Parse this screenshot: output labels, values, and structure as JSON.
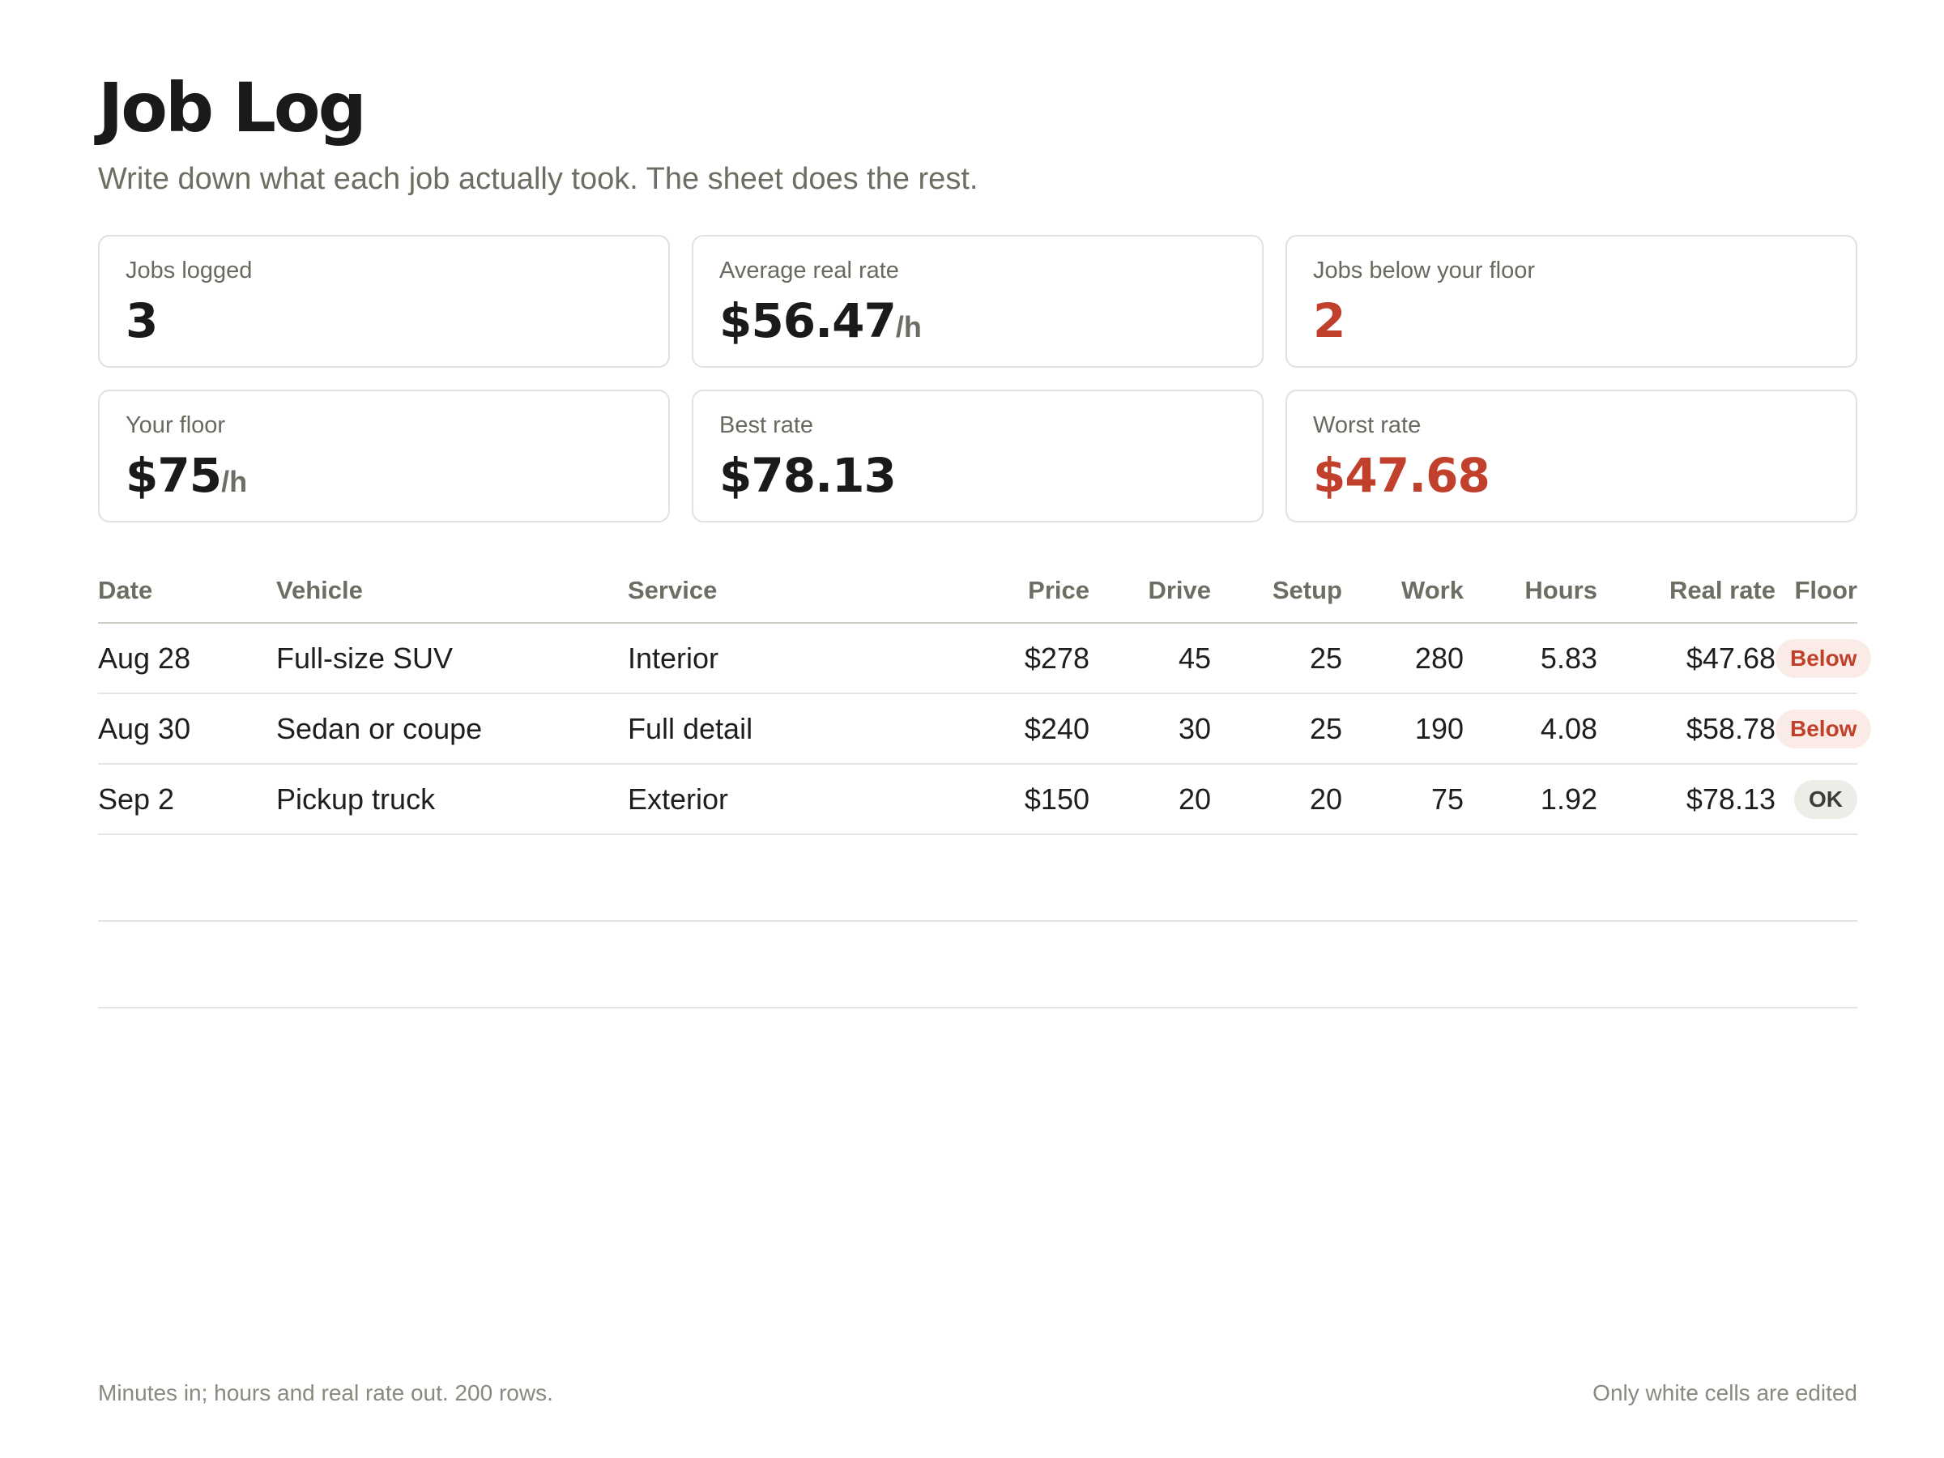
{
  "header": {
    "title": "Job Log",
    "subtitle": "Write down what each job actually took. The sheet does the rest."
  },
  "stats": [
    {
      "label": "Jobs logged",
      "value": "3",
      "unit": "",
      "alert": false
    },
    {
      "label": "Average real rate",
      "value": "$56.47",
      "unit": "/h",
      "alert": false
    },
    {
      "label": "Jobs below your floor",
      "value": "2",
      "unit": "",
      "alert": true
    },
    {
      "label": "Your floor",
      "value": "$75",
      "unit": "/h",
      "alert": false
    },
    {
      "label": "Best rate",
      "value": "$78.13",
      "unit": "",
      "alert": false
    },
    {
      "label": "Worst rate",
      "value": "$47.68",
      "unit": "",
      "alert": true
    }
  ],
  "table": {
    "columns": [
      "Date",
      "Vehicle",
      "Service",
      "Price",
      "Drive",
      "Setup",
      "Work",
      "Hours",
      "Real rate",
      "Floor"
    ],
    "rows": [
      {
        "date": "Aug 28",
        "vehicle": "Full-size SUV",
        "service": "Interior",
        "price": "$278",
        "drive": "45",
        "setup": "25",
        "work": "280",
        "hours": "5.83",
        "rate": "$47.68",
        "floor": "Below",
        "floor_status": "below"
      },
      {
        "date": "Aug 30",
        "vehicle": "Sedan or coupe",
        "service": "Full detail",
        "price": "$240",
        "drive": "30",
        "setup": "25",
        "work": "190",
        "hours": "4.08",
        "rate": "$58.78",
        "floor": "Below",
        "floor_status": "below"
      },
      {
        "date": "Sep 2",
        "vehicle": "Pickup truck",
        "service": "Exterior",
        "price": "$150",
        "drive": "20",
        "setup": "20",
        "work": "75",
        "hours": "1.92",
        "rate": "$78.13",
        "floor": "OK",
        "floor_status": "ok"
      }
    ]
  },
  "footer": {
    "left": "Minutes in; hours and real rate out. 200 rows.",
    "right": "Only white cells are edited"
  },
  "colors": {
    "alert": "#c0402b",
    "muted": "#6e6d63",
    "ok_badge_bg": "#ebede7",
    "below_badge_bg": "#fbebe6"
  }
}
